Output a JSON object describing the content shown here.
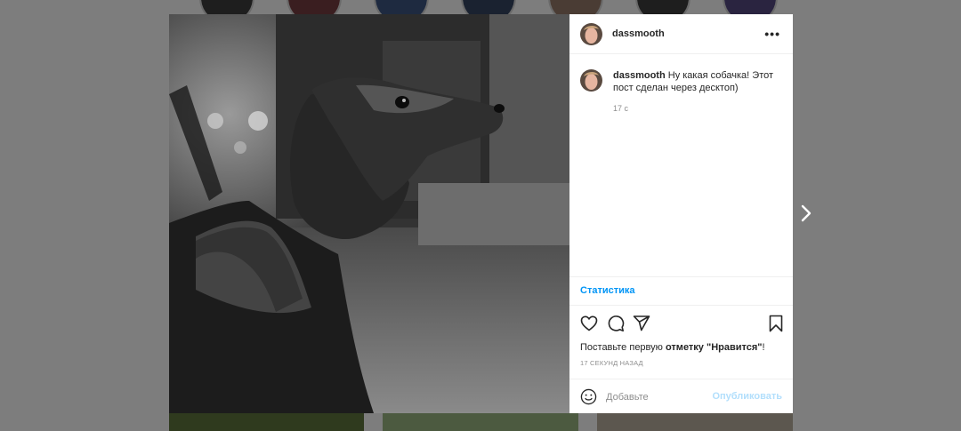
{
  "post": {
    "username": "dassmooth",
    "more_label": "•••",
    "caption_author": "dassmooth",
    "caption_text": "Ну какая собачка! Этот пост сделан через десктоп)",
    "caption_time": "17 с",
    "stats_label": "Статистика",
    "likes_prefix": "Поставьте первую",
    "likes_bold": "отметку \"Нравится\"",
    "likes_suffix": "!",
    "posted_ago": "17 СЕКУНД НАЗАД",
    "comment_placeholder": "Добавьте",
    "publish_label": "Опубликовать"
  },
  "icons": {
    "like": "heart-icon",
    "comment": "comment-icon",
    "share": "paper-plane-icon",
    "save": "bookmark-icon",
    "emoji": "smiley-icon",
    "next": "chevron-right-icon",
    "more": "ellipsis-icon"
  },
  "colors": {
    "overlay": "#7d7d7d",
    "link": "#0095f6",
    "publish_disabled": "#b2dffc",
    "muted": "#8e8e8e"
  }
}
